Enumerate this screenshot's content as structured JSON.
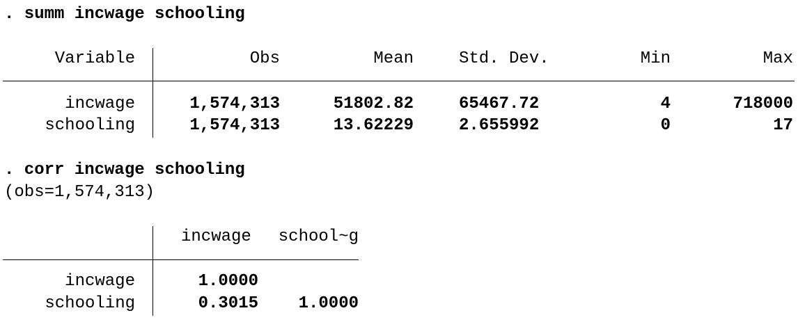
{
  "summ": {
    "command": ". summ incwage schooling",
    "headers": [
      "Variable",
      "Obs",
      "Mean",
      "Std. Dev.",
      "Min",
      "Max"
    ],
    "rows": [
      {
        "variable": "incwage",
        "obs": "1,574,313",
        "mean": "51802.82",
        "sd": "65467.72",
        "min": "4",
        "max": "718000"
      },
      {
        "variable": "schooling",
        "obs": "1,574,313",
        "mean": "13.62229",
        "sd": "2.655992",
        "min": "0",
        "max": "17"
      }
    ]
  },
  "corr": {
    "command": ". corr incwage schooling",
    "obs_note": "(obs=1,574,313)",
    "headers": [
      "incwage",
      "school~g"
    ],
    "rows": [
      {
        "variable": "incwage",
        "values": [
          "1.0000",
          ""
        ]
      },
      {
        "variable": "schooling",
        "values": [
          "0.3015",
          "1.0000"
        ]
      }
    ]
  }
}
